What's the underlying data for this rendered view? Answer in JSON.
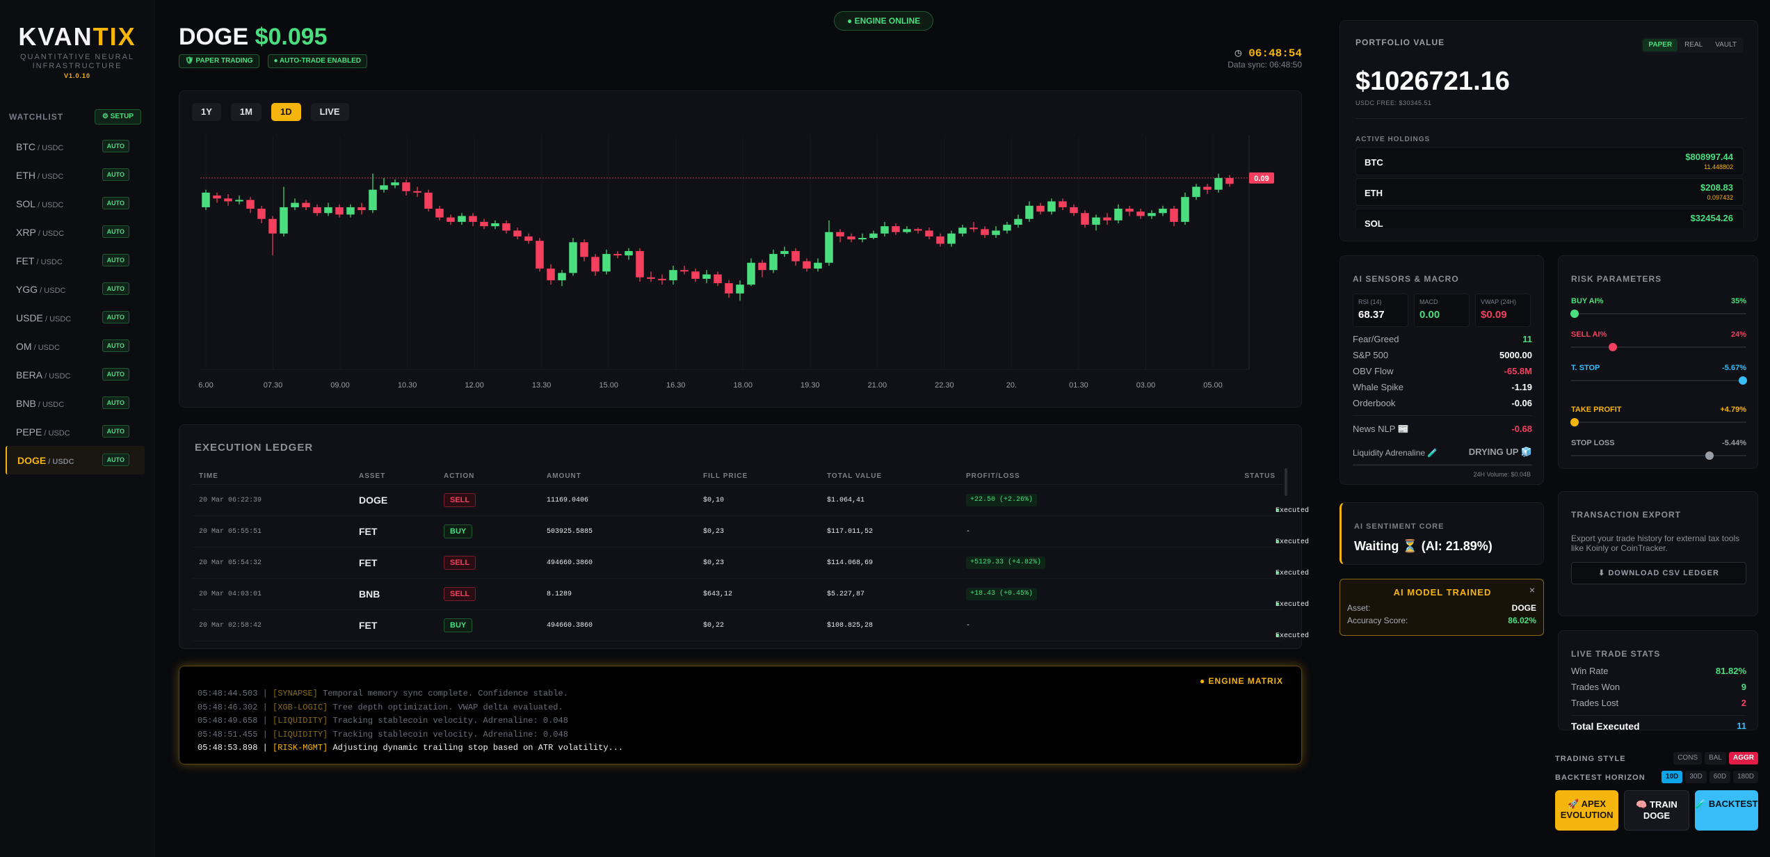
{
  "brand": {
    "name_main": "KVAN",
    "name_accent": "TIX",
    "subtitle": "QUANTITATIVE NEURAL INFRASTRUCTURE",
    "version": "V1.0.10"
  },
  "watchlist": {
    "title": "WATCHLIST",
    "setup_label": "⚙ SETUP",
    "items": [
      {
        "base": "BTC",
        "quote": " / USDC",
        "badge": "AUTO"
      },
      {
        "base": "ETH",
        "quote": " / USDC",
        "badge": "AUTO"
      },
      {
        "base": "SOL",
        "quote": " / USDC",
        "badge": "AUTO"
      },
      {
        "base": "XRP",
        "quote": " / USDC",
        "badge": "AUTO"
      },
      {
        "base": "FET",
        "quote": " / USDC",
        "badge": "AUTO"
      },
      {
        "base": "YGG",
        "quote": " / USDC",
        "badge": "AUTO"
      },
      {
        "base": "USDE",
        "quote": " / USDC",
        "badge": "AUTO"
      },
      {
        "base": "OM",
        "quote": " / USDC",
        "badge": "AUTO"
      },
      {
        "base": "BERA",
        "quote": " / USDC",
        "badge": "AUTO"
      },
      {
        "base": "BNB",
        "quote": " / USDC",
        "badge": "AUTO"
      },
      {
        "base": "PEPE",
        "quote": " / USDC",
        "badge": "AUTO"
      },
      {
        "base": "DOGE",
        "quote": " / USDC",
        "badge": "AUTO"
      }
    ]
  },
  "header": {
    "asset": "DOGE",
    "price": "$0.095",
    "badge_paper": "🛡 PAPER TRADING",
    "badge_auto": "● AUTO-TRADE ENABLED",
    "engine_status": "● ENGINE ONLINE",
    "clock": "06:48:54",
    "data_sync": "Data sync: 06:48:50"
  },
  "chart": {
    "timeframes": [
      "1Y",
      "1M",
      "1D",
      "LIVE"
    ],
    "active_timeframe": "1D",
    "price_tag": "0.09",
    "x_labels": [
      "6.00",
      "07.30",
      "09.00",
      "10.30",
      "12.00",
      "13.30",
      "15.00",
      "16.30",
      "18.00",
      "19.30",
      "21.00",
      "22.30",
      "20.",
      "01.30",
      "03.00",
      "05.00"
    ]
  },
  "chart_data": {
    "type": "candlestick",
    "title": "",
    "ylim": [
      0.0795,
      0.0955
    ],
    "last_price": 0.0926,
    "candles": [
      [
        0.0906,
        0.0916,
        0.0918,
        0.0904
      ],
      [
        0.0914,
        0.0912,
        0.0916,
        0.0909
      ],
      [
        0.0912,
        0.091,
        0.0915,
        0.0907
      ],
      [
        0.091,
        0.0911,
        0.0914,
        0.0908
      ],
      [
        0.0911,
        0.0905,
        0.0913,
        0.0902
      ],
      [
        0.0905,
        0.0898,
        0.0907,
        0.0895
      ],
      [
        0.0898,
        0.0888,
        0.09,
        0.0873
      ],
      [
        0.0888,
        0.0906,
        0.092,
        0.0886
      ],
      [
        0.0906,
        0.0909,
        0.0912,
        0.0904
      ],
      [
        0.0909,
        0.0906,
        0.0911,
        0.0904
      ],
      [
        0.0906,
        0.0902,
        0.0908,
        0.09
      ],
      [
        0.0902,
        0.0906,
        0.0909,
        0.09
      ],
      [
        0.0906,
        0.0901,
        0.0908,
        0.0899
      ],
      [
        0.0901,
        0.0906,
        0.0908,
        0.0899
      ],
      [
        0.0906,
        0.0904,
        0.0909,
        0.0901
      ],
      [
        0.0904,
        0.0918,
        0.0929,
        0.0902
      ],
      [
        0.0918,
        0.0921,
        0.0926,
        0.0916
      ],
      [
        0.0921,
        0.0923,
        0.0925,
        0.0919
      ],
      [
        0.0923,
        0.0917,
        0.0925,
        0.0914
      ],
      [
        0.0917,
        0.0916,
        0.092,
        0.0913
      ],
      [
        0.0916,
        0.0905,
        0.0918,
        0.0903
      ],
      [
        0.0905,
        0.0899,
        0.0907,
        0.0897
      ],
      [
        0.0899,
        0.0896,
        0.0901,
        0.0894
      ],
      [
        0.0896,
        0.09,
        0.0902,
        0.0894
      ],
      [
        0.09,
        0.0896,
        0.0902,
        0.0893
      ],
      [
        0.0896,
        0.0893,
        0.0898,
        0.0891
      ],
      [
        0.0893,
        0.0895,
        0.0897,
        0.0891
      ],
      [
        0.0895,
        0.089,
        0.0897,
        0.0888
      ],
      [
        0.089,
        0.0886,
        0.0892,
        0.0884
      ],
      [
        0.0886,
        0.0883,
        0.0888,
        0.0881
      ],
      [
        0.0883,
        0.0864,
        0.0885,
        0.0862
      ],
      [
        0.0864,
        0.0856,
        0.0867,
        0.0853
      ],
      [
        0.0856,
        0.0861,
        0.0863,
        0.0852
      ],
      [
        0.0861,
        0.0882,
        0.0885,
        0.0859
      ],
      [
        0.0882,
        0.0872,
        0.0884,
        0.0869
      ],
      [
        0.0872,
        0.0862,
        0.0874,
        0.0859
      ],
      [
        0.0862,
        0.0874,
        0.0877,
        0.086
      ],
      [
        0.0874,
        0.0873,
        0.0876,
        0.0871
      ],
      [
        0.0873,
        0.0876,
        0.0878,
        0.087
      ],
      [
        0.0876,
        0.0858,
        0.0878,
        0.0855
      ],
      [
        0.0858,
        0.0857,
        0.0862,
        0.0855
      ],
      [
        0.0857,
        0.0856,
        0.086,
        0.0853
      ],
      [
        0.0856,
        0.0863,
        0.0866,
        0.0853
      ],
      [
        0.0863,
        0.0862,
        0.0866,
        0.086
      ],
      [
        0.0862,
        0.0857,
        0.0864,
        0.0855
      ],
      [
        0.0857,
        0.086,
        0.0863,
        0.0854
      ],
      [
        0.086,
        0.0854,
        0.0862,
        0.0852
      ],
      [
        0.0854,
        0.0847,
        0.0856,
        0.0844
      ],
      [
        0.0847,
        0.0853,
        0.0856,
        0.0842
      ],
      [
        0.0853,
        0.0868,
        0.0871,
        0.0852
      ],
      [
        0.0868,
        0.0863,
        0.087,
        0.0858
      ],
      [
        0.0863,
        0.0874,
        0.0877,
        0.0861
      ],
      [
        0.0874,
        0.0876,
        0.0879,
        0.0872
      ],
      [
        0.0876,
        0.0869,
        0.0878,
        0.0866
      ],
      [
        0.0869,
        0.0864,
        0.0871,
        0.0862
      ],
      [
        0.0864,
        0.0868,
        0.0871,
        0.0862
      ],
      [
        0.0868,
        0.0889,
        0.0897,
        0.0866
      ],
      [
        0.0889,
        0.0886,
        0.0891,
        0.0882
      ],
      [
        0.0886,
        0.0884,
        0.0888,
        0.0882
      ],
      [
        0.0884,
        0.0885,
        0.0888,
        0.0882
      ],
      [
        0.0885,
        0.0888,
        0.089,
        0.0884
      ],
      [
        0.0888,
        0.0893,
        0.0896,
        0.0886
      ],
      [
        0.0893,
        0.0889,
        0.0895,
        0.0887
      ],
      [
        0.0889,
        0.0891,
        0.0893,
        0.0888
      ],
      [
        0.0891,
        0.089,
        0.0892,
        0.0888
      ],
      [
        0.089,
        0.0886,
        0.0892,
        0.0884
      ],
      [
        0.0886,
        0.0881,
        0.0888,
        0.0879
      ],
      [
        0.0881,
        0.0888,
        0.089,
        0.0879
      ],
      [
        0.0888,
        0.0892,
        0.0894,
        0.0886
      ],
      [
        0.0892,
        0.0891,
        0.0896,
        0.0889
      ],
      [
        0.0891,
        0.0887,
        0.0893,
        0.0885
      ],
      [
        0.0887,
        0.089,
        0.0893,
        0.0885
      ],
      [
        0.089,
        0.0894,
        0.0896,
        0.0888
      ],
      [
        0.0894,
        0.0898,
        0.0901,
        0.0892
      ],
      [
        0.0898,
        0.0907,
        0.091,
        0.0896
      ],
      [
        0.0907,
        0.0903,
        0.0909,
        0.0901
      ],
      [
        0.0903,
        0.091,
        0.0912,
        0.0901
      ],
      [
        0.091,
        0.0906,
        0.0912,
        0.0904
      ],
      [
        0.0906,
        0.0902,
        0.0908,
        0.09
      ],
      [
        0.0902,
        0.0894,
        0.0904,
        0.0892
      ],
      [
        0.0894,
        0.0899,
        0.0901,
        0.089
      ],
      [
        0.0899,
        0.0897,
        0.0902,
        0.0894
      ],
      [
        0.0897,
        0.0905,
        0.0908,
        0.0895
      ],
      [
        0.0905,
        0.0903,
        0.0907,
        0.09
      ],
      [
        0.0903,
        0.09,
        0.0905,
        0.0898
      ],
      [
        0.09,
        0.0902,
        0.0904,
        0.0898
      ],
      [
        0.0902,
        0.0905,
        0.0907,
        0.09
      ],
      [
        0.0905,
        0.0896,
        0.0907,
        0.0893
      ],
      [
        0.0896,
        0.0913,
        0.0916,
        0.0894
      ],
      [
        0.0913,
        0.092,
        0.0922,
        0.0911
      ],
      [
        0.092,
        0.0918,
        0.0922,
        0.0915
      ],
      [
        0.0918,
        0.0926,
        0.0929,
        0.0916
      ],
      [
        0.0926,
        0.0922,
        0.0928,
        0.092
      ]
    ]
  },
  "ledger": {
    "title": "EXECUTION LEDGER",
    "columns": [
      "TIME",
      "ASSET",
      "ACTION",
      "AMOUNT",
      "FILL PRICE",
      "TOTAL VALUE",
      "PROFIT/LOSS",
      "STATUS"
    ],
    "rows": [
      {
        "time": "20 Mar 06:22:39",
        "asset": "DOGE",
        "action": "SELL",
        "amount": "11169.0406",
        "fill": "$0,10",
        "total": "$1.064,41",
        "pl": "+22.50 (+2.26%)",
        "status": "Executed"
      },
      {
        "time": "20 Mar 05:55:51",
        "asset": "FET",
        "action": "BUY",
        "amount": "503925.5885",
        "fill": "$0,23",
        "total": "$117.011,52",
        "pl": "-",
        "status": "Executed"
      },
      {
        "time": "20 Mar 05:54:32",
        "asset": "FET",
        "action": "SELL",
        "amount": "494660.3860",
        "fill": "$0,23",
        "total": "$114.068,69",
        "pl": "+5129.33 (+4.82%)",
        "status": "Executed"
      },
      {
        "time": "20 Mar 04:03:01",
        "asset": "BNB",
        "action": "SELL",
        "amount": "8.1289",
        "fill": "$643,12",
        "total": "$5.227,87",
        "pl": "+18.43 (+0.45%)",
        "status": "Executed"
      },
      {
        "time": "20 Mar 02:58:42",
        "asset": "FET",
        "action": "BUY",
        "amount": "494660.3860",
        "fill": "$0,22",
        "total": "$108.825,28",
        "pl": "-",
        "status": "Executed"
      }
    ]
  },
  "console": {
    "label": "● ENGINE MATRIX",
    "lines": [
      {
        "ts": "05:48:44.503 | ",
        "tag": "[SYNAPSE]",
        "msg": " Temporal memory sync complete. Confidence stable."
      },
      {
        "ts": "05:48:46.302 | ",
        "tag": "[XGB-LOGIC]",
        "msg": " Tree depth optimization. VWAP delta evaluated."
      },
      {
        "ts": "05:48:49.658 | ",
        "tag": "[LIQUIDITY]",
        "msg": " Tracking stablecoin velocity. Adrenaline: 0.048"
      },
      {
        "ts": "05:48:51.455 | ",
        "tag": "[LIQUIDITY]",
        "msg": " Tracking stablecoin velocity. Adrenaline: 0.048"
      },
      {
        "ts": "05:48:53.898 | ",
        "tag": "[RISK-MGMT]",
        "msg": " Adjusting dynamic trailing stop based on ATR volatility..."
      }
    ]
  },
  "portfolio": {
    "label": "PORTFOLIO VALUE",
    "modes": [
      "PAPER",
      "REAL",
      "VAULT"
    ],
    "value": "$1026721.16",
    "free": "USDC FREE: $30345.51",
    "holdings_label": "ACTIVE HOLDINGS",
    "holdings": [
      {
        "sym": "BTC",
        "value": "$808997.44",
        "qty": "11.448802"
      },
      {
        "sym": "ETH",
        "value": "$208.83",
        "qty": "0.097432"
      },
      {
        "sym": "SOL",
        "value": "$32454.26",
        "qty": ""
      }
    ]
  },
  "sensors": {
    "title": "AI SENSORS & MACRO",
    "cards": [
      {
        "label": "RSI (14)",
        "value": "68.37",
        "color": "#ffffff"
      },
      {
        "label": "MACD",
        "value": "0.00",
        "color": "#4ade80"
      },
      {
        "label": "VWAP (24H)",
        "value": "$0.09",
        "color": "#f43f5e"
      }
    ],
    "rows": [
      {
        "k": "Fear/Greed",
        "v": "11",
        "color": "#4ade80"
      },
      {
        "k": "S&P 500",
        "v": "5000.00",
        "color": "#ffffff"
      },
      {
        "k": "OBV Flow",
        "v": "-65.8M",
        "color": "#f43f5e"
      },
      {
        "k": "Whale Spike",
        "v": "-1.19",
        "color": "#ffffff"
      },
      {
        "k": "Orderbook",
        "v": "-0.06",
        "color": "#ffffff"
      }
    ],
    "news_label": "News NLP 📰",
    "news_value": "-0.68",
    "adrenaline_label": "Liquidity Adrenaline 🧪",
    "adrenaline_value": "DRYING UP 🧊",
    "volume": "24H Volume: $0.04B"
  },
  "sentiment": {
    "label": "AI SENTIMENT CORE",
    "value": "Waiting ⏳ (AI: 21.89%)"
  },
  "trained": {
    "title": "AI MODEL TRAINED",
    "close": "×",
    "asset_label": "Asset:",
    "asset": "DOGE",
    "acc_label": "Accuracy Score:",
    "acc": "86.02%"
  },
  "risk": {
    "title": "RISK PARAMETERS",
    "params": [
      {
        "label": "BUY AI%",
        "value": "35%",
        "color": "#4ade80",
        "level": 0.02
      },
      {
        "label": "SELL AI%",
        "value": "24%",
        "color": "#f43f5e",
        "level": 0.24
      },
      {
        "label": "T. STOP",
        "value": "-5.67%",
        "color": "#38bdf8",
        "level": 0.98
      },
      {
        "label": "TAKE PROFIT",
        "value": "+4.79%",
        "color": "#f5b50d",
        "level": 0.02
      },
      {
        "label": "STOP LOSS",
        "value": "-5.44%",
        "color": "#9a9ea7",
        "level": 0.79
      }
    ]
  },
  "export": {
    "title": "TRANSACTION EXPORT",
    "text": "Export your trade history for external tax tools like Koinly or CoinTracker.",
    "button": "⬇ DOWNLOAD CSV LEDGER"
  },
  "stats": {
    "title": "LIVE TRADE STATS",
    "rows": [
      {
        "k": "Win Rate",
        "v": "81.82%",
        "color": "#4ade80"
      },
      {
        "k": "Trades Won",
        "v": "9",
        "color": "#4ade80"
      },
      {
        "k": "Trades Lost",
        "v": "2",
        "color": "#f43f5e"
      }
    ],
    "total_label": "Total Executed",
    "total_value": "11"
  },
  "trading_style": {
    "label": "TRADING STYLE",
    "options": [
      "CONS",
      "BAL",
      "AGGR"
    ],
    "active": "AGGR"
  },
  "backtest_horizon": {
    "label": "BACKTEST HORIZON",
    "options": [
      "10D",
      "30D",
      "60D",
      "180D"
    ],
    "active": "10D"
  },
  "actions": {
    "apex": "🚀 APEX EVOLUTION",
    "train": "🧠 TRAIN DOGE",
    "backtest": "🧪 BACKTEST"
  }
}
